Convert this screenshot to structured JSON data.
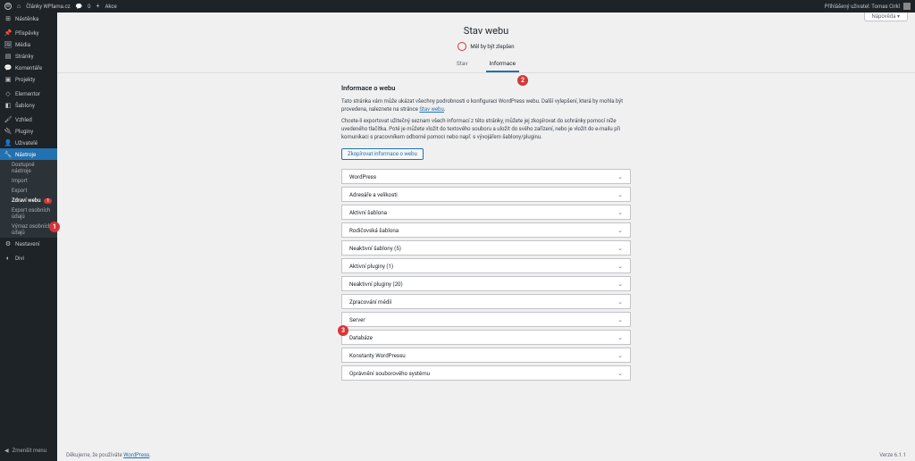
{
  "topbar": {
    "site": "Články WPlama.cz",
    "comments": "0",
    "new": "Akce",
    "greeting": "Přihlášený uživatel: Tomas Cirkl"
  },
  "help_tab": "Nápověda ▾",
  "sidebar": {
    "items": [
      {
        "icon": "⚙",
        "label": "Nástěnka"
      },
      {
        "icon": "✎",
        "label": "Příspěvky"
      },
      {
        "icon": "▣",
        "label": "Média"
      },
      {
        "icon": "▤",
        "label": "Stránky"
      },
      {
        "icon": "💬",
        "label": "Komentáře"
      },
      {
        "icon": "▣",
        "label": "Projekty"
      },
      {
        "icon": "◇",
        "label": "Elementor"
      },
      {
        "icon": "◧",
        "label": "Šablony"
      },
      {
        "icon": "🖌",
        "label": "Vzhled"
      },
      {
        "icon": "🔌",
        "label": "Pluginy"
      },
      {
        "icon": "👤",
        "label": "Uživatelé"
      },
      {
        "icon": "🔧",
        "label": "Nástroje"
      }
    ],
    "subs": [
      "Dostupné nástroje",
      "Import",
      "Export",
      "Zdraví webu",
      "Export osobních údajů",
      "Výmaz osobních údajů"
    ],
    "sub_badge": "1",
    "after": [
      {
        "icon": "⚙",
        "label": "Nastavení"
      },
      {
        "icon": "◐",
        "label": "Divi"
      }
    ],
    "collapse": "Zmenšit menu"
  },
  "page": {
    "title": "Stav webu",
    "status": "Měl by být zlepšen",
    "tabs": [
      "Stav",
      "Informace"
    ],
    "heading": "Informace o webu",
    "p1a": "Tato stránka vám může ukázat všechny podrobnosti o konfiguraci WordPress webu. Další vylepšení, která by mohla být provedena, naleznete na stránce ",
    "p1link": "Stav webu",
    "p2": "Chcete-li exportovat užitečný seznam všech informací z této stránky, můžete jej zkopírovat do schránky pomocí níže uvedeného tlačítka. Poté je můžete vložit do textového souboru a uložit do svého zařízení, nebo je vložit do e-mailu při komunikaci s pracovníkem odborné pomoci nebo např. s vývojářem šablony/pluginu.",
    "button": "Zkopírovat informace o webu",
    "accordions": [
      "WordPress",
      "Adresáře a velikosti",
      "Aktivní šablona",
      "Rodičovská šablona",
      "Neaktivní šablony (5)",
      "Aktivní pluginy (1)",
      "Neaktivní pluginy (20)",
      "Zpracování médií",
      "Server",
      "Databáze",
      "Konstanty WordPressu",
      "Oprávnění souborového systému"
    ]
  },
  "footer": {
    "thanks": "Děkujeme, že používáte ",
    "link": "WordPress",
    "version": "Verze 6.1.1"
  },
  "callouts": [
    "1",
    "2",
    "3"
  ]
}
